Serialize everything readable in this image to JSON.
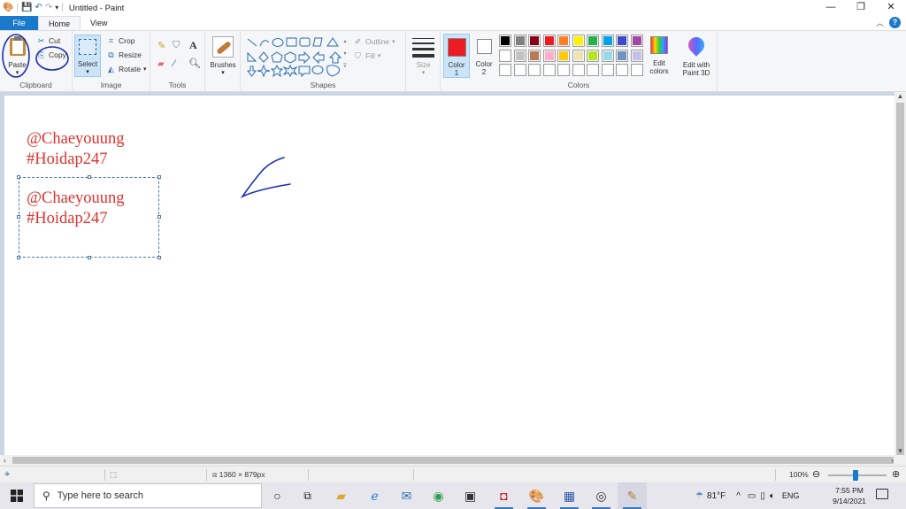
{
  "window": {
    "title": "Untitled - Paint",
    "controls": {
      "minimize": "—",
      "restore": "❐",
      "close": "✕"
    }
  },
  "quick_access": [
    "paint-app-icon",
    "save-icon",
    "undo-icon",
    "redo-icon",
    "customize-arrow-icon"
  ],
  "tabs": {
    "file": "File",
    "home": "Home",
    "view": "View"
  },
  "clipboard": {
    "paste": "Paste",
    "cut": "Cut",
    "copy": "Copy",
    "group_label": "Clipboard"
  },
  "image": {
    "select": "Select",
    "crop": "Crop",
    "resize": "Resize",
    "rotate": "Rotate",
    "group_label": "Image"
  },
  "tools": {
    "group_label": "Tools",
    "items": [
      "pencil-icon",
      "fill-icon",
      "text-icon",
      "eraser-icon",
      "color-picker-icon",
      "magnifier-icon"
    ]
  },
  "brushes": {
    "label": "Brushes"
  },
  "shapes": {
    "outline": "Outline",
    "fill": "Fill",
    "group_label": "Shapes"
  },
  "size": {
    "label": "Size"
  },
  "color_selectors": {
    "color1_line1": "Color",
    "color1_line2": "1",
    "color2_line1": "Color",
    "color2_line2": "2",
    "color1": "#ed1c24",
    "color2": "#ffffff"
  },
  "colors": {
    "group_label": "Colors",
    "row1": [
      "#000000",
      "#7f7f7f",
      "#880015",
      "#ed1c24",
      "#ff7f27",
      "#fff200",
      "#22b14c",
      "#00a2e8",
      "#3f48cc",
      "#a349a4"
    ],
    "row2": [
      "#ffffff",
      "#c3c3c3",
      "#b97a57",
      "#ffaec9",
      "#ffc90e",
      "#efe4b0",
      "#b5e61d",
      "#99d9ea",
      "#7092be",
      "#c8bfe7"
    ],
    "row3": [
      "#ffffff",
      "#ffffff",
      "#ffffff",
      "#ffffff",
      "#ffffff",
      "#ffffff",
      "#ffffff",
      "#ffffff",
      "#ffffff",
      "#ffffff"
    ],
    "edit_colors_line1": "Edit",
    "edit_colors_line2": "colors",
    "paint3d_line1": "Edit with",
    "paint3d_line2": "Paint 3D"
  },
  "canvas_content": {
    "text_block_1": {
      "line1": "@Chaeyouung",
      "line2": "#Hoidap247"
    },
    "text_block_2": {
      "line1": "@Chaeyouung",
      "line2": "#Hoidap247"
    },
    "text_color": "#e0322d",
    "annotation_color": "#1a2faa"
  },
  "status": {
    "dimensions": "1360 × 879px",
    "zoom": "100%"
  },
  "taskbar": {
    "search_placeholder": "Type here to search",
    "weather": "81°F",
    "language": "ENG",
    "time": "7:55 PM",
    "date": "9/14/2021"
  }
}
